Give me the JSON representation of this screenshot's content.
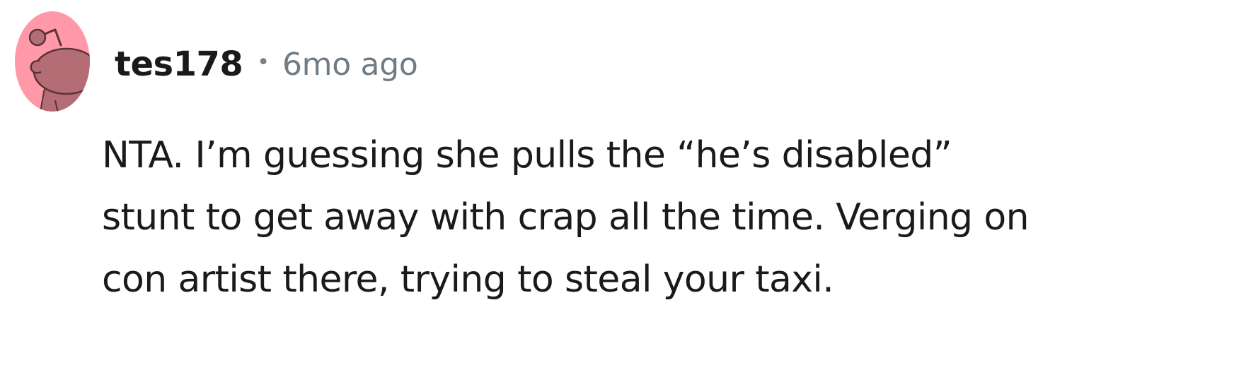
{
  "comment": {
    "avatar_icon": "reddit-snoo-avatar-icon",
    "avatar_bg_color": "#ff99aa",
    "avatar_fg_color": "#b46c75",
    "username": "tes178",
    "separator": "•",
    "timestamp": "6mo ago",
    "body_lines": [
      "NTA. I’m guessing she pulls the “he’s disabled”",
      "stunt to get away with crap all the time. Verging on",
      "con artist there, trying to steal your taxi."
    ]
  }
}
